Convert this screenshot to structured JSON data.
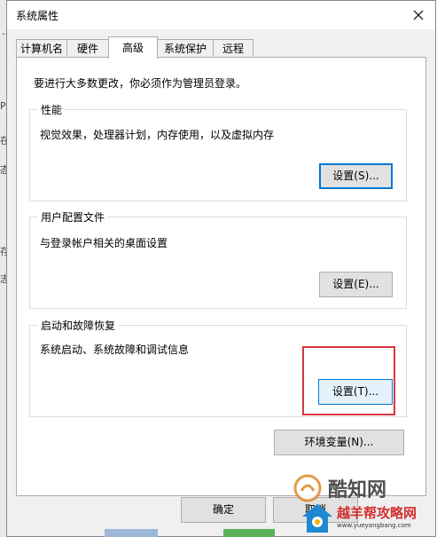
{
  "background_window": {
    "fragments": [
      "P",
      "在",
      "态",
      "存",
      "志"
    ]
  },
  "dialog": {
    "title": "系统属性"
  },
  "tabs": [
    {
      "label": "计算机名",
      "active": false
    },
    {
      "label": "硬件",
      "active": false
    },
    {
      "label": "高级",
      "active": true
    },
    {
      "label": "系统保护",
      "active": false
    },
    {
      "label": "远程",
      "active": false
    }
  ],
  "notice": "要进行大多数更改，你必须作为管理员登录。",
  "sections": {
    "performance": {
      "label": "性能",
      "description": "视觉效果，处理器计划，内存使用，以及虚拟内存",
      "button": "设置(S)..."
    },
    "user_profiles": {
      "label": "用户配置文件",
      "description": "与登录帐户相关的桌面设置",
      "button": "设置(E)..."
    },
    "startup_recovery": {
      "label": "启动和故障恢复",
      "description": "系统启动、系统故障和调试信息",
      "button": "设置(T)..."
    }
  },
  "env_button": "环境变量(N)...",
  "bottom_buttons": {
    "ok": "确定",
    "cancel": "取消"
  },
  "watermarks": {
    "primary": "酷知网",
    "secondary_title": "越羊帮攻略网",
    "secondary_url": "www.yueyangbang.com"
  },
  "colors": {
    "highlight_border": "#d9363e",
    "focus_blue": "#0078d7"
  }
}
